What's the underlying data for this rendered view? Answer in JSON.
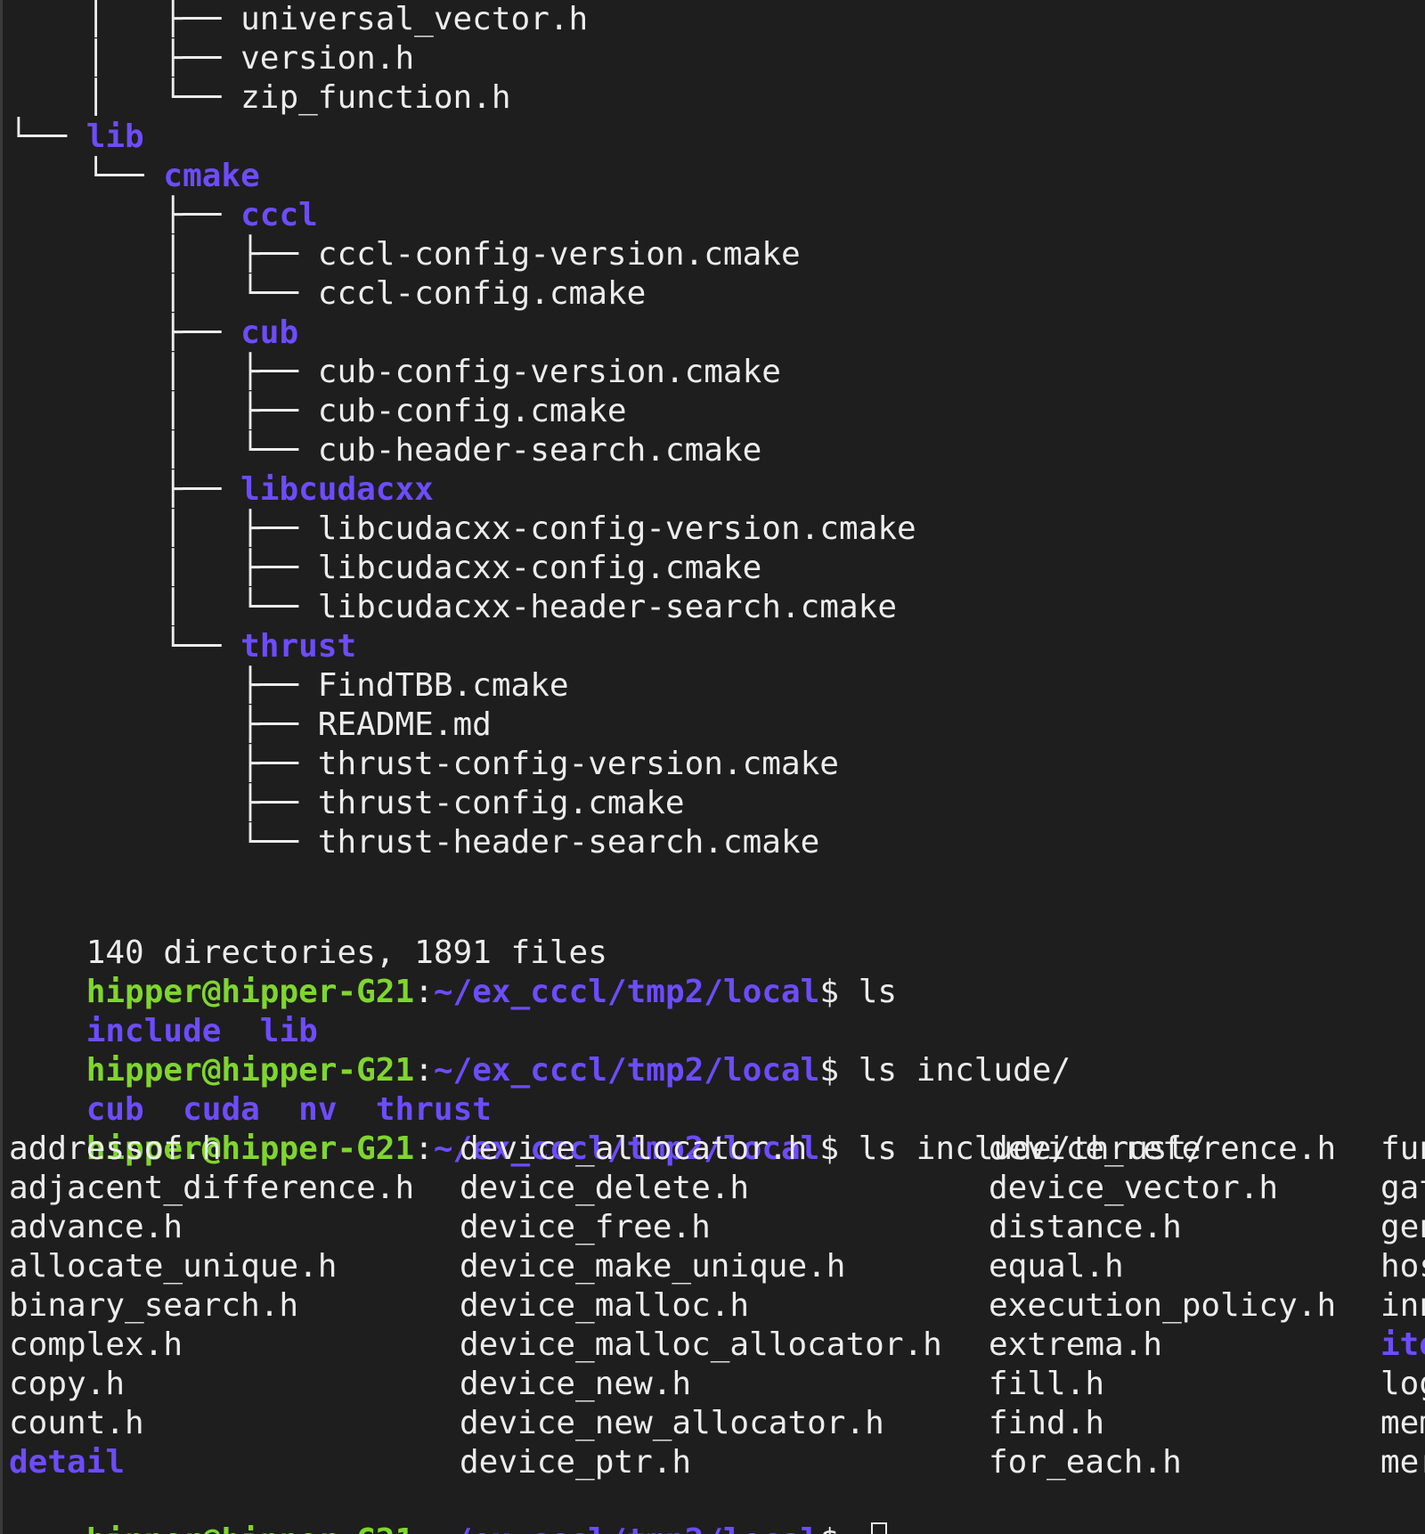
{
  "window": {
    "title": "Terminal"
  },
  "tree_lines": [
    {
      "prefix": "    │   ├── ",
      "name": "universal_vector.h",
      "type": "file"
    },
    {
      "prefix": "    │   ├── ",
      "name": "version.h",
      "type": "file"
    },
    {
      "prefix": "    │   └── ",
      "name": "zip_function.h",
      "type": "file"
    },
    {
      "prefix": "└── ",
      "name": "lib",
      "type": "dir"
    },
    {
      "prefix": "    └── ",
      "name": "cmake",
      "type": "dir"
    },
    {
      "prefix": "        ├── ",
      "name": "cccl",
      "type": "dir"
    },
    {
      "prefix": "        │   ├── ",
      "name": "cccl-config-version.cmake",
      "type": "file"
    },
    {
      "prefix": "        │   └── ",
      "name": "cccl-config.cmake",
      "type": "file"
    },
    {
      "prefix": "        ├── ",
      "name": "cub",
      "type": "dir"
    },
    {
      "prefix": "        │   ├── ",
      "name": "cub-config-version.cmake",
      "type": "file"
    },
    {
      "prefix": "        │   ├── ",
      "name": "cub-config.cmake",
      "type": "file"
    },
    {
      "prefix": "        │   └── ",
      "name": "cub-header-search.cmake",
      "type": "file"
    },
    {
      "prefix": "        ├── ",
      "name": "libcudacxx",
      "type": "dir"
    },
    {
      "prefix": "        │   ├── ",
      "name": "libcudacxx-config-version.cmake",
      "type": "file"
    },
    {
      "prefix": "        │   ├── ",
      "name": "libcudacxx-config.cmake",
      "type": "file"
    },
    {
      "prefix": "        │   └── ",
      "name": "libcudacxx-header-search.cmake",
      "type": "file"
    },
    {
      "prefix": "        └── ",
      "name": "thrust",
      "type": "dir"
    },
    {
      "prefix": "            ├── ",
      "name": "FindTBB.cmake",
      "type": "file"
    },
    {
      "prefix": "            ├── ",
      "name": "README.md",
      "type": "file"
    },
    {
      "prefix": "            ├── ",
      "name": "thrust-config-version.cmake",
      "type": "file"
    },
    {
      "prefix": "            ├── ",
      "name": "thrust-config.cmake",
      "type": "file"
    },
    {
      "prefix": "            └── ",
      "name": "thrust-header-search.cmake",
      "type": "file"
    }
  ],
  "summary": "140 directories, 1891 files",
  "prompt": {
    "user_host": "hipper@hipper-G21",
    "colon": ":",
    "path": "~/ex_cccl/tmp2/local",
    "dollar": "$ "
  },
  "commands": [
    {
      "cmd": "ls",
      "output": [
        "include",
        "lib"
      ]
    },
    {
      "cmd": "ls include/",
      "output": [
        "cub",
        "cuda",
        "nv",
        "thrust"
      ]
    },
    {
      "cmd": "ls include/thrust/"
    }
  ],
  "thrust_listing": {
    "col1": [
      {
        "name": "addressof.h",
        "type": "file"
      },
      {
        "name": "adjacent_difference.h",
        "type": "file"
      },
      {
        "name": "advance.h",
        "type": "file"
      },
      {
        "name": "allocate_unique.h",
        "type": "file"
      },
      {
        "name": "binary_search.h",
        "type": "file"
      },
      {
        "name": "complex.h",
        "type": "file"
      },
      {
        "name": "copy.h",
        "type": "file"
      },
      {
        "name": "count.h",
        "type": "file"
      },
      {
        "name": "detail",
        "type": "dir"
      }
    ],
    "col2": [
      {
        "name": "device_allocator.h",
        "type": "file"
      },
      {
        "name": "device_delete.h",
        "type": "file"
      },
      {
        "name": "device_free.h",
        "type": "file"
      },
      {
        "name": "device_make_unique.h",
        "type": "file"
      },
      {
        "name": "device_malloc.h",
        "type": "file"
      },
      {
        "name": "device_malloc_allocator.h",
        "type": "file"
      },
      {
        "name": "device_new.h",
        "type": "file"
      },
      {
        "name": "device_new_allocator.h",
        "type": "file"
      },
      {
        "name": "device_ptr.h",
        "type": "file"
      }
    ],
    "col3": [
      {
        "name": "device_reference.h",
        "type": "file"
      },
      {
        "name": "device_vector.h",
        "type": "file"
      },
      {
        "name": "distance.h",
        "type": "file"
      },
      {
        "name": "equal.h",
        "type": "file"
      },
      {
        "name": "execution_policy.h",
        "type": "file"
      },
      {
        "name": "extrema.h",
        "type": "file"
      },
      {
        "name": "fill.h",
        "type": "file"
      },
      {
        "name": "find.h",
        "type": "file"
      },
      {
        "name": "for_each.h",
        "type": "file"
      }
    ],
    "col4": [
      {
        "name": "fun",
        "type": "file"
      },
      {
        "name": "gat",
        "type": "file"
      },
      {
        "name": "gen",
        "type": "file"
      },
      {
        "name": "hos",
        "type": "file"
      },
      {
        "name": "inn",
        "type": "file"
      },
      {
        "name": "ite",
        "type": "dir"
      },
      {
        "name": "log",
        "type": "file"
      },
      {
        "name": "mem",
        "type": "file"
      },
      {
        "name": "mer",
        "type": "file"
      }
    ]
  },
  "colors": {
    "background": "#1e1e1e",
    "text": "#ececec",
    "directory": "#6d4cff",
    "prompt_user": "#7fd62e"
  }
}
